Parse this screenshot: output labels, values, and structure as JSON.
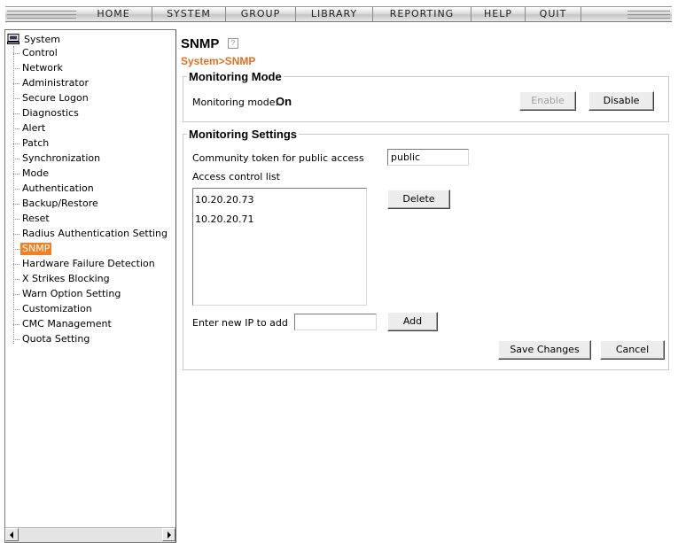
{
  "nav": {
    "items": [
      "HOME",
      "SYSTEM",
      "GROUP",
      "LIBRARY",
      "REPORTING",
      "HELP",
      "QUIT"
    ]
  },
  "sidebar": {
    "root_label": "System",
    "root_icon": "computer-icon",
    "items": [
      {
        "label": "Control"
      },
      {
        "label": "Network"
      },
      {
        "label": "Administrator"
      },
      {
        "label": "Secure Logon"
      },
      {
        "label": "Diagnostics"
      },
      {
        "label": "Alert"
      },
      {
        "label": "Patch"
      },
      {
        "label": "Synchronization"
      },
      {
        "label": "Mode"
      },
      {
        "label": "Authentication"
      },
      {
        "label": "Backup/Restore"
      },
      {
        "label": "Reset"
      },
      {
        "label": "Radius Authentication Setting"
      },
      {
        "label": "SNMP",
        "selected": true
      },
      {
        "label": "Hardware Failure Detection"
      },
      {
        "label": "X Strikes Blocking"
      },
      {
        "label": "Warn Option Setting"
      },
      {
        "label": "Customization"
      },
      {
        "label": "CMC Management"
      },
      {
        "label": "Quota Setting"
      }
    ],
    "selected_color": "#f08020"
  },
  "page": {
    "title": "SNMP",
    "help_glyph": "?",
    "breadcrumb": "System>SNMP",
    "accent_color": "#e07020"
  },
  "monitoring_mode": {
    "legend": "Monitoring Mode",
    "label": "Monitoring mode:",
    "value": "On",
    "enable_label": "Enable",
    "enable_disabled": true,
    "disable_label": "Disable"
  },
  "monitoring_settings": {
    "legend": "Monitoring Settings",
    "community_label": "Community token for public access",
    "community_value": "public",
    "acl_label": "Access control list",
    "acl_items": [
      "10.20.20.73",
      "10.20.20.71"
    ],
    "delete_label": "Delete",
    "new_ip_label": "Enter new IP to add",
    "new_ip_value": "",
    "add_label": "Add",
    "save_label": "Save Changes",
    "cancel_label": "Cancel"
  }
}
